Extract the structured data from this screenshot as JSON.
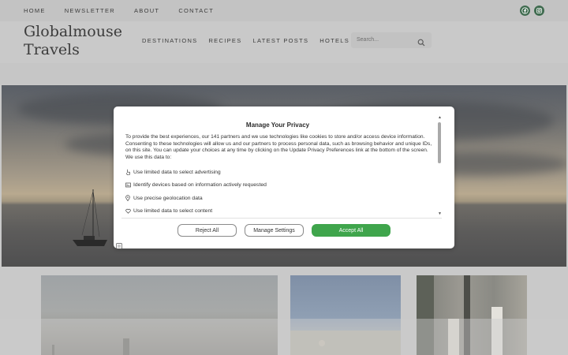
{
  "topbar": {
    "nav": [
      "HOME",
      "NEWSLETTER",
      "ABOUT",
      "CONTACT"
    ],
    "social_icons": [
      "facebook-icon",
      "instagram-icon"
    ]
  },
  "header": {
    "logo_line1": "Globalmouse",
    "logo_line2": "Travels",
    "nav": [
      "DESTINATIONS",
      "RECIPES",
      "LATEST POSTS",
      "HOTELS & RESORTS"
    ],
    "search_placeholder": "Search..."
  },
  "modal": {
    "title": "Manage Your Privacy",
    "body": "To provide the best experiences, our 141 partners and we use technologies like cookies to store and/or access device information. Consenting to these technologies will allow us and our partners to process personal data, such as browsing behavior and unique IDs, on this site. You can update your choices at any time by clicking on the Update Privacy Preferences link at the bottom of the screen. We use this data to:",
    "items": [
      {
        "icon": "hand-pointer-icon",
        "label": "Use limited data to select advertising"
      },
      {
        "icon": "id-card-icon",
        "label": "Identify devices based on information actively requested"
      },
      {
        "icon": "map-pin-icon",
        "label": "Use precise geolocation data"
      },
      {
        "icon": "heart-icon",
        "label": "Use limited data to select content"
      }
    ],
    "buttons": {
      "reject": "Reject All",
      "manage": "Manage Settings",
      "accept": "Accept All"
    }
  },
  "colors": {
    "accent_green": "#3fa54c",
    "social_green": "#3f6b4f"
  }
}
